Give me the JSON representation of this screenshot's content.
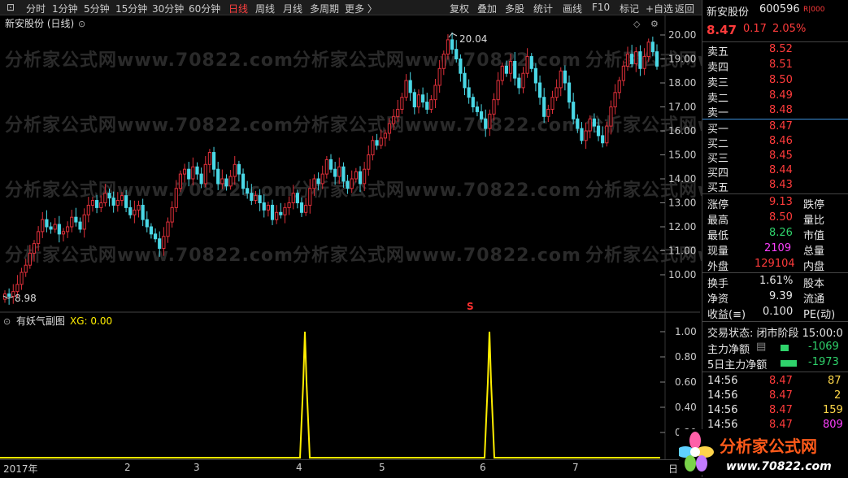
{
  "toolbar": {
    "items": [
      "分时",
      "1分钟",
      "5分钟",
      "15分钟",
      "30分钟",
      "60分钟",
      "日线",
      "周线",
      "月线",
      "多周期",
      "更多 〉"
    ],
    "right_items": [
      "复权",
      "叠加",
      "多股",
      "统计",
      "画线",
      "F10",
      "标记",
      "+自选",
      "返回"
    ]
  },
  "chart": {
    "title": "新安股份 (日线)",
    "high_label": "20.04",
    "low_label": "8.98",
    "s_marker": "S",
    "y_ticks": [
      "20.00",
      "19.00",
      "18.00",
      "17.00",
      "16.00",
      "15.00",
      "14.00",
      "13.00",
      "12.00",
      "11.00",
      "10.00"
    ],
    "sub_title": "有妖气副图",
    "sub_value": "XG: 0.00",
    "sub_y_ticks": [
      "1.00",
      "0.80",
      "0.60",
      "0.40",
      "0.20"
    ],
    "x_labels": [
      "2017年",
      "2",
      "3",
      "4",
      "5",
      "6",
      "7",
      "日"
    ]
  },
  "watermark": "分析家公式网www.70822.com",
  "colors": {
    "up": "#e0303a",
    "down": "#4ad8e6",
    "xg": "#ffee00"
  },
  "chart_data": {
    "type": "candlestick",
    "xg_spikes_at_labels": [
      "4",
      "6"
    ],
    "candles": [
      [
        8.98,
        9.2
      ],
      [
        9.2,
        9.1
      ],
      [
        9.1,
        9.3
      ],
      [
        9.3,
        9.6
      ],
      [
        9.6,
        10.1
      ],
      [
        10.1,
        10.4
      ],
      [
        10.4,
        10.9
      ],
      [
        10.9,
        11.3
      ],
      [
        11.3,
        11.8
      ],
      [
        11.8,
        12.3
      ],
      [
        12.3,
        12.0
      ],
      [
        12.0,
        11.9
      ],
      [
        11.9,
        12.1
      ],
      [
        12.1,
        11.7
      ],
      [
        11.7,
        11.8
      ],
      [
        11.8,
        12.0
      ],
      [
        12.0,
        12.4
      ],
      [
        12.4,
        12.2
      ],
      [
        12.2,
        11.9
      ],
      [
        11.9,
        12.5
      ],
      [
        12.5,
        12.9
      ],
      [
        12.9,
        13.1
      ],
      [
        13.1,
        12.8
      ],
      [
        12.8,
        13.0
      ],
      [
        13.0,
        13.4
      ],
      [
        13.4,
        13.2
      ],
      [
        13.2,
        12.9
      ],
      [
        12.9,
        13.1
      ],
      [
        13.1,
        13.3
      ],
      [
        13.3,
        12.8
      ],
      [
        12.8,
        12.5
      ],
      [
        12.5,
        12.7
      ],
      [
        12.7,
        12.9
      ],
      [
        12.9,
        12.3
      ],
      [
        12.3,
        12.0
      ],
      [
        12.0,
        11.7
      ],
      [
        11.7,
        11.5
      ],
      [
        11.5,
        11.1
      ],
      [
        11.1,
        11.6
      ],
      [
        11.6,
        12.2
      ],
      [
        12.2,
        12.8
      ],
      [
        12.8,
        13.6
      ],
      [
        13.6,
        14.2
      ],
      [
        14.2,
        14.4
      ],
      [
        14.4,
        14.0
      ],
      [
        14.0,
        14.5
      ],
      [
        14.5,
        14.2
      ],
      [
        14.2,
        13.8
      ],
      [
        13.8,
        14.6
      ],
      [
        14.6,
        15.1
      ],
      [
        15.1,
        14.4
      ],
      [
        14.4,
        13.8
      ],
      [
        13.8,
        14.0
      ],
      [
        14.0,
        13.7
      ],
      [
        13.7,
        14.1
      ],
      [
        14.1,
        14.6
      ],
      [
        14.6,
        14.2
      ],
      [
        14.2,
        13.6
      ],
      [
        13.6,
        13.4
      ],
      [
        13.4,
        13.1
      ],
      [
        13.1,
        13.3
      ],
      [
        13.3,
        13.0
      ],
      [
        13.0,
        12.7
      ],
      [
        12.7,
        12.9
      ],
      [
        12.9,
        12.3
      ],
      [
        12.3,
        12.6
      ],
      [
        12.6,
        12.5
      ],
      [
        12.5,
        12.8
      ],
      [
        12.8,
        13.0
      ],
      [
        13.0,
        13.4
      ],
      [
        13.4,
        13.0
      ],
      [
        13.0,
        12.6
      ],
      [
        12.6,
        12.9
      ],
      [
        12.9,
        13.6
      ],
      [
        13.6,
        14.0
      ],
      [
        14.0,
        13.8
      ],
      [
        13.8,
        14.2
      ],
      [
        14.2,
        14.8
      ],
      [
        14.8,
        14.4
      ],
      [
        14.4,
        14.1
      ],
      [
        14.1,
        14.5
      ],
      [
        14.5,
        13.9
      ],
      [
        13.9,
        13.6
      ],
      [
        13.6,
        14.0
      ],
      [
        14.0,
        14.3
      ],
      [
        14.3,
        13.8
      ],
      [
        13.8,
        14.4
      ],
      [
        14.4,
        15.0
      ],
      [
        15.0,
        15.6
      ],
      [
        15.6,
        15.4
      ],
      [
        15.4,
        15.7
      ],
      [
        15.7,
        15.9
      ],
      [
        15.9,
        16.3
      ],
      [
        16.3,
        16.6
      ],
      [
        16.6,
        16.9
      ],
      [
        16.9,
        17.4
      ],
      [
        17.4,
        18.1
      ],
      [
        18.1,
        17.6
      ],
      [
        17.6,
        17.0
      ],
      [
        17.0,
        17.5
      ],
      [
        17.5,
        17.2
      ],
      [
        17.2,
        16.9
      ],
      [
        16.9,
        17.3
      ],
      [
        17.3,
        17.9
      ],
      [
        17.9,
        18.6
      ],
      [
        18.6,
        19.2
      ],
      [
        19.2,
        19.8
      ],
      [
        19.8,
        19.4
      ],
      [
        19.4,
        19.0
      ],
      [
        19.0,
        18.4
      ],
      [
        18.4,
        17.8
      ],
      [
        17.8,
        17.4
      ],
      [
        17.4,
        17.0
      ],
      [
        17.0,
        16.8
      ],
      [
        16.8,
        16.5
      ],
      [
        16.5,
        16.1
      ],
      [
        16.1,
        16.7
      ],
      [
        16.7,
        17.3
      ],
      [
        17.3,
        18.1
      ],
      [
        18.1,
        18.7
      ],
      [
        18.7,
        18.4
      ],
      [
        18.4,
        18.9
      ],
      [
        18.9,
        18.2
      ],
      [
        18.2,
        17.8
      ],
      [
        17.8,
        18.4
      ],
      [
        18.4,
        19.1
      ],
      [
        19.1,
        18.6
      ],
      [
        18.6,
        18.0
      ],
      [
        18.0,
        17.4
      ],
      [
        17.4,
        16.6
      ],
      [
        16.6,
        16.9
      ],
      [
        16.9,
        17.4
      ],
      [
        17.4,
        17.8
      ],
      [
        17.8,
        18.5
      ],
      [
        18.5,
        18.0
      ],
      [
        18.0,
        17.2
      ],
      [
        17.2,
        16.5
      ],
      [
        16.5,
        16.1
      ],
      [
        16.1,
        15.6
      ],
      [
        15.6,
        16.0
      ],
      [
        16.0,
        16.5
      ],
      [
        16.5,
        16.2
      ],
      [
        16.2,
        15.8
      ],
      [
        15.8,
        15.5
      ],
      [
        15.5,
        16.2
      ],
      [
        16.2,
        17.0
      ],
      [
        17.0,
        17.6
      ],
      [
        17.6,
        18.1
      ],
      [
        18.1,
        18.7
      ],
      [
        18.7,
        19.2
      ],
      [
        19.2,
        18.8
      ],
      [
        18.8,
        19.3
      ],
      [
        19.3,
        18.6
      ],
      [
        18.6,
        19.1
      ],
      [
        19.1,
        19.7
      ],
      [
        19.7,
        19.3
      ],
      [
        19.3,
        18.7
      ]
    ]
  },
  "sidebar": {
    "stock_name": "新安股份",
    "stock_code": "600596",
    "badge": "R|000",
    "price": "8.47",
    "change": "0.17",
    "change_pct": "2.05%",
    "sells": [
      [
        "卖五",
        "8.52"
      ],
      [
        "卖四",
        "8.51"
      ],
      [
        "卖三",
        "8.50"
      ],
      [
        "卖二",
        "8.49"
      ],
      [
        "卖一",
        "8.48"
      ]
    ],
    "buys": [
      [
        "买一",
        "8.47"
      ],
      [
        "买二",
        "8.46"
      ],
      [
        "买三",
        "8.45"
      ],
      [
        "买四",
        "8.44"
      ],
      [
        "买五",
        "8.43"
      ]
    ],
    "stats": {
      "zhangting_label": "涨停",
      "zhangting": "9.13",
      "dieting_label": "跌停",
      "zuigao_label": "最高",
      "zuigao": "8.50",
      "liangbi_label": "量比",
      "zuidi_label": "最低",
      "zuidi": "8.26",
      "shizhi_label": "市值",
      "xianliang_label": "现量",
      "xianliang": "2109",
      "zongliang_label": "总量",
      "waipan_label": "外盘",
      "waipan": "129104",
      "neipan_label": "内盘",
      "huanshou_label": "换手",
      "huanshou": "1.61%",
      "guben_label": "股本",
      "jingzi_label": "净资",
      "jingzi": "9.39",
      "liutong_label": "流通",
      "shouyi_label": "收益(≡)",
      "shouyi": "0.100",
      "pe_label": "PE(动)"
    },
    "status_label": "交易状态: 闭市阶段 15:00:0",
    "fund_label": "主力净额",
    "fund_value": "-1069",
    "fund5_label": "5日主力净额",
    "fund5_value": "-1973",
    "ticks": [
      [
        "14:56",
        "8.47",
        "87"
      ],
      [
        "14:56",
        "8.47",
        "2"
      ],
      [
        "14:56",
        "8.47",
        "159"
      ],
      [
        "14:56",
        "8.47",
        "809"
      ]
    ]
  },
  "logo": {
    "text": "分析家公式网",
    "url": "www.70822.com"
  }
}
